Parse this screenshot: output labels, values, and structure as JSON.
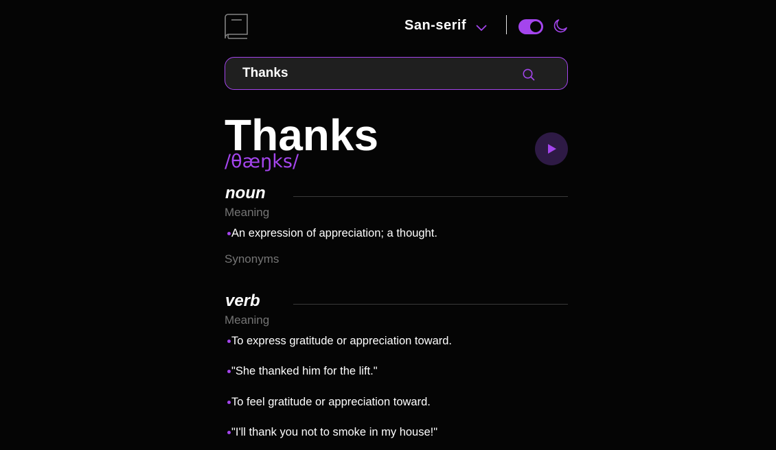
{
  "header": {
    "font_label": "San-serif",
    "colors": {
      "accent": "#a445ed",
      "background": "#050505",
      "search_bg": "#1f1f1f",
      "muted": "#757575"
    },
    "icons": [
      "book-logo-icon",
      "chevron-down-icon",
      "moon-icon",
      "search-icon",
      "play-icon"
    ]
  },
  "search": {
    "value": "Thanks"
  },
  "entry": {
    "word": "Thanks",
    "phonetic": "/θæŋks/"
  },
  "meanings": [
    {
      "part_of_speech": "noun",
      "meaning_label": "Meaning",
      "definitions": [
        "An expression of appreciation; a thought."
      ],
      "synonyms_label": "Synonyms"
    },
    {
      "part_of_speech": "verb",
      "meaning_label": "Meaning",
      "definitions": [
        "To express gratitude or appreciation toward.",
        "\"She thanked him for the lift.\"",
        "To feel gratitude or appreciation toward.",
        "\"I'll thank you not to smoke in my house!\""
      ]
    }
  ]
}
